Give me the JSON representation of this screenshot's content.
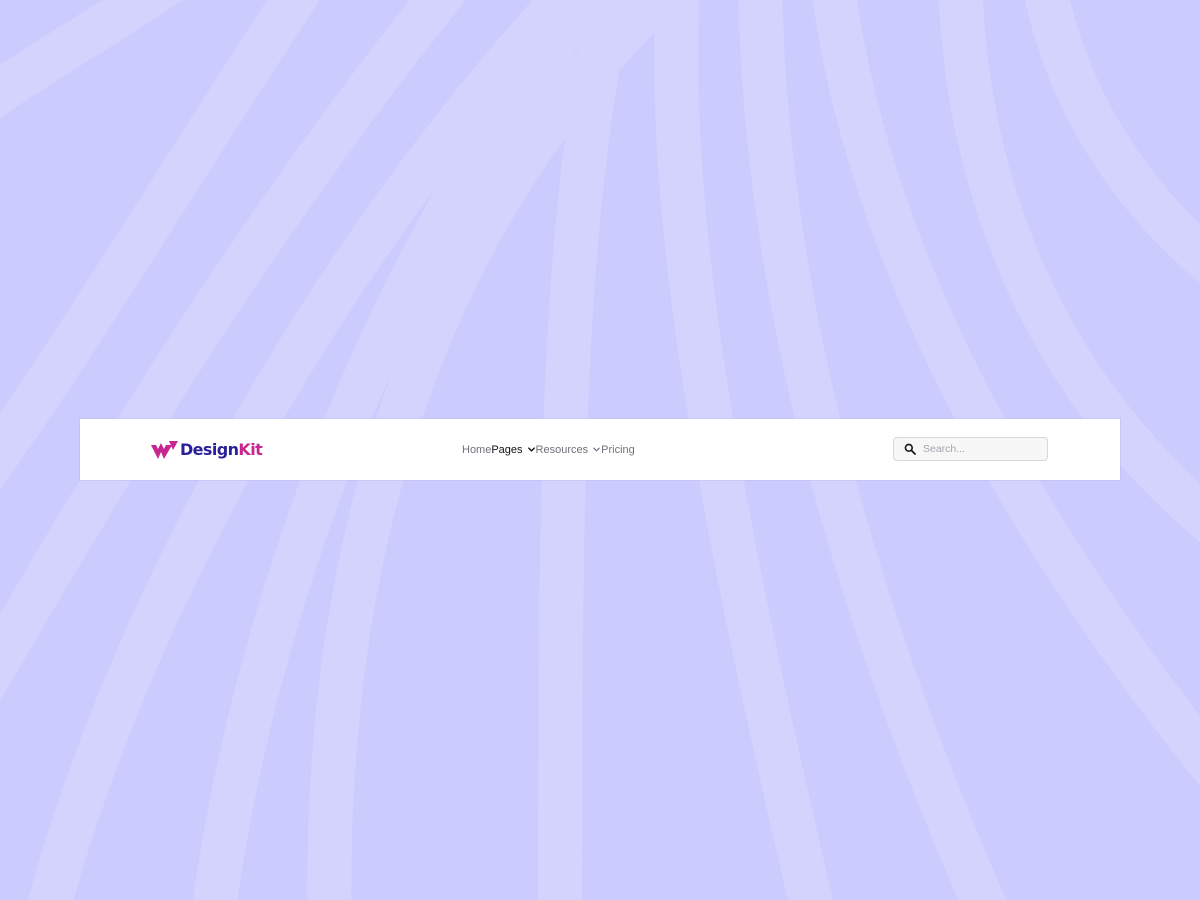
{
  "theme": {
    "background": "#cccbfd",
    "stripe": "#d4d3fe",
    "brand_primary": "#2a1f9a",
    "brand_accent": "#c7258f",
    "nav_text": "#71717a",
    "nav_active": "#111111"
  },
  "brand": {
    "name_part_1": "Design",
    "name_part_2": "Kit",
    "logo_icon": "designkit-logo-mark-icon"
  },
  "nav": {
    "items": [
      {
        "label": "Home",
        "active": false,
        "has_dropdown": false
      },
      {
        "label": "Pages",
        "active": true,
        "has_dropdown": true
      },
      {
        "label": "Resources",
        "active": false,
        "has_dropdown": true
      },
      {
        "label": "Pricing",
        "active": false,
        "has_dropdown": false
      }
    ]
  },
  "search": {
    "placeholder": "Search...",
    "value": "",
    "icon": "search-icon"
  }
}
